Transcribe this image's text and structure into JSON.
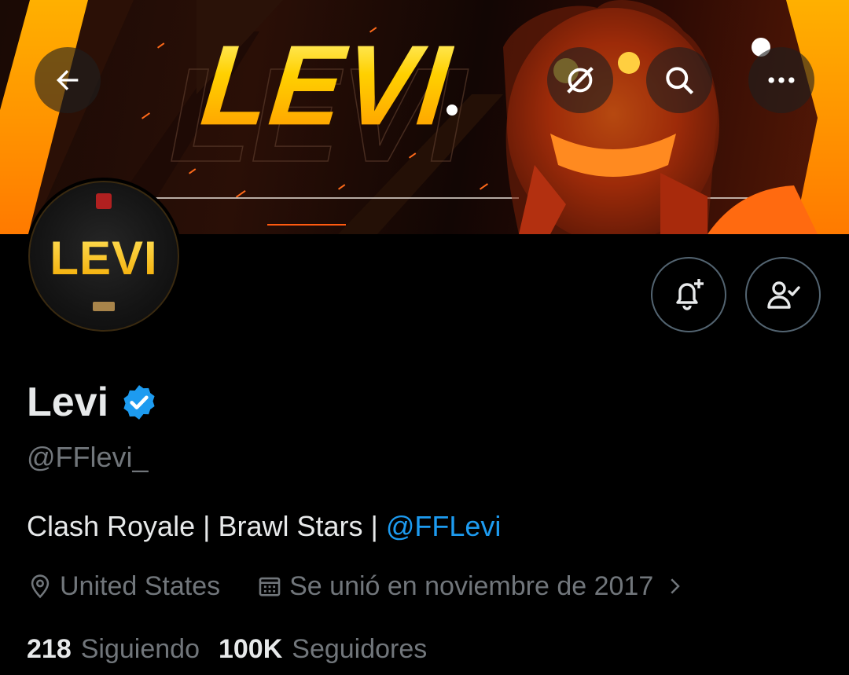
{
  "header": {
    "banner_title": "LEVI",
    "back_icon": "arrow-left-icon",
    "grok_icon": "grok-icon",
    "search_icon": "search-icon",
    "more_icon": "more-horizontal-icon"
  },
  "profile": {
    "avatar_text": "LEVI",
    "display_name": "Levi",
    "verified_icon": "verified-badge-icon",
    "handle": "@FFlevi_",
    "bio_text": "Clash Royale | Brawl Stars | ",
    "bio_link": "@FFLevi",
    "location": "United States",
    "joined": "Se unió en noviembre de 2017",
    "following_count": "218",
    "following_label": "Siguiendo",
    "followers_count": "100K",
    "followers_label": "Seguidores"
  },
  "actions": {
    "notify_icon": "bell-plus-icon",
    "following_icon": "user-check-icon"
  },
  "colors": {
    "background": "#000000",
    "text_primary": "#e7e9ea",
    "text_secondary": "#71767b",
    "link": "#1d9bf0",
    "verified": "#1d9bf0",
    "banner_accent": "#ffc400"
  }
}
